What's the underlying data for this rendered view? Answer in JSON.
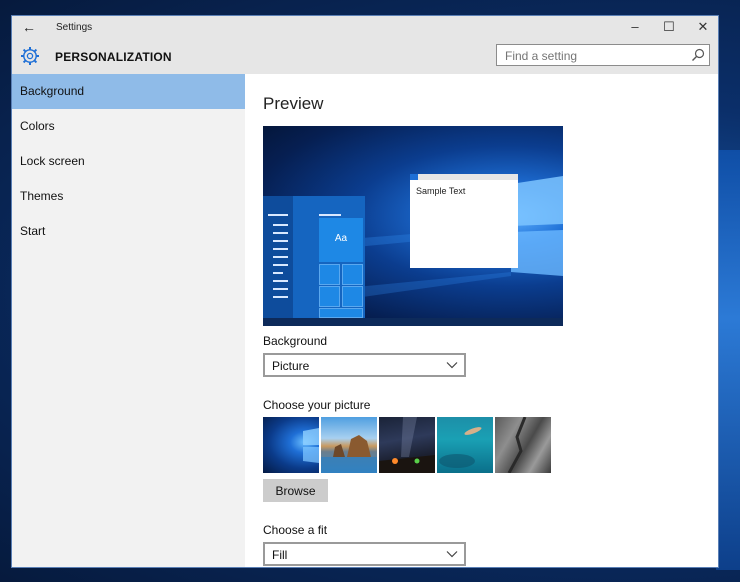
{
  "window": {
    "title": "Settings",
    "back_icon": "back-arrow-icon",
    "controls": {
      "minimize": "–",
      "maximize": "☐",
      "close": "✕"
    }
  },
  "header": {
    "icon": "gear-icon",
    "heading": "PERSONALIZATION",
    "search_placeholder": "Find a setting",
    "search_icon": "search-icon"
  },
  "sidebar": {
    "items": [
      {
        "label": "Background",
        "active": true
      },
      {
        "label": "Colors",
        "active": false
      },
      {
        "label": "Lock screen",
        "active": false
      },
      {
        "label": "Themes",
        "active": false
      },
      {
        "label": "Start",
        "active": false
      }
    ]
  },
  "main": {
    "preview_title": "Preview",
    "preview": {
      "sample_text": "Sample Text",
      "tile_text": "Aa"
    },
    "background": {
      "label": "Background",
      "value": "Picture"
    },
    "picture": {
      "label": "Choose your picture",
      "thumbnails": [
        "windows-hero-blue",
        "beach-sea-stacks",
        "night-sky-tent",
        "underwater-swimmer",
        "rock-cliff"
      ]
    },
    "browse_label": "Browse",
    "fit": {
      "label": "Choose a fit",
      "value": "Fill"
    }
  },
  "colors": {
    "accent": "#1e6fd6",
    "selected_nav": "#8fbbe8",
    "title_bar": "#e6e6e6"
  }
}
